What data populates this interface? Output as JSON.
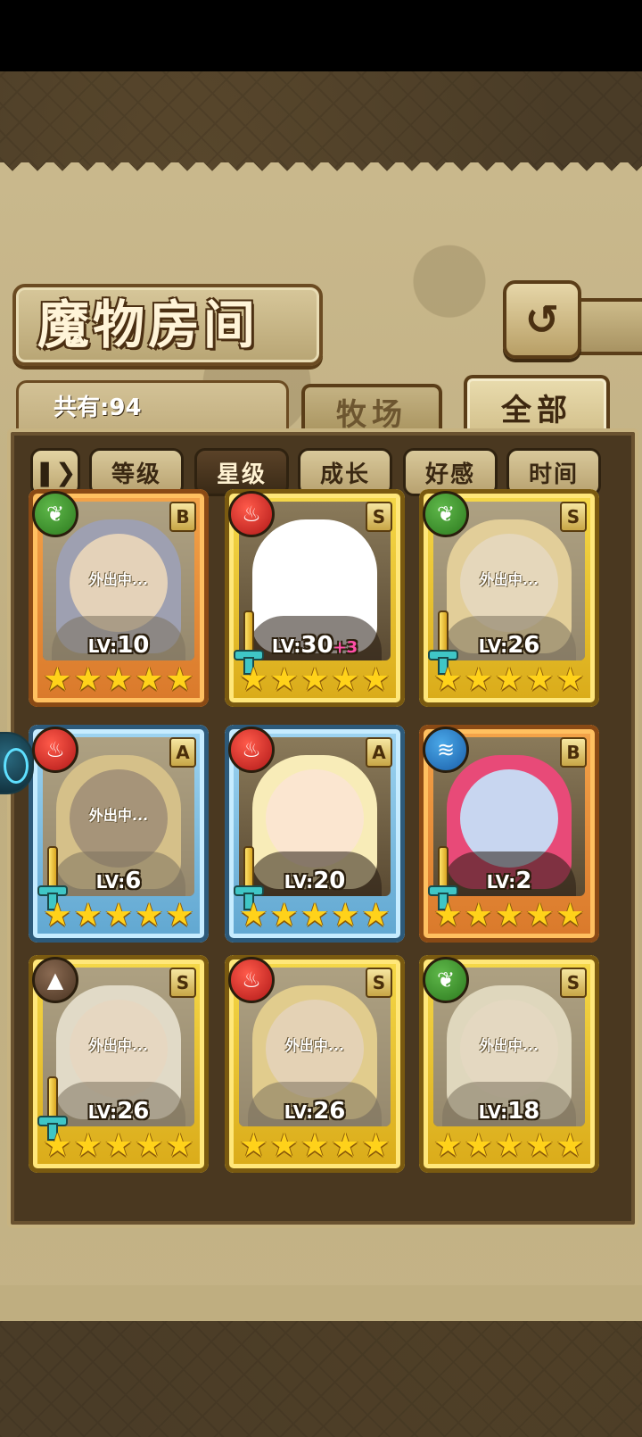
{
  "header": {
    "title": "魔物房间",
    "back_icon": "back-arrow-icon"
  },
  "count_label": "共有:94",
  "tabs": [
    {
      "label": "牧场",
      "active": false
    },
    {
      "label": "全部",
      "active": true
    }
  ],
  "sort": {
    "toggle_icon": "pause-sort-icon",
    "buttons": [
      {
        "label": "等级",
        "active": false
      },
      {
        "label": "星级",
        "active": true
      },
      {
        "label": "成长",
        "active": false
      },
      {
        "label": "好感",
        "active": false
      },
      {
        "label": "时间",
        "active": false
      }
    ]
  },
  "monsters": [
    {
      "element": "nature",
      "rank": "B",
      "frame": "orange",
      "away": "外出中...",
      "level": "10",
      "bonus": "",
      "sword": false,
      "stars": 5,
      "hair": "#6a78b8",
      "skin": "#f6dcc8"
    },
    {
      "element": "fire",
      "rank": "S",
      "frame": "gold",
      "away": "",
      "level": "30",
      "bonus": "+3",
      "sword": true,
      "stars": 5,
      "hair": "#ffffff",
      "skin": "#ffffff"
    },
    {
      "element": "nature",
      "rank": "S",
      "frame": "gold",
      "away": "外出中...",
      "level": "26",
      "bonus": "",
      "sword": true,
      "stars": 5,
      "hair": "#f2d488",
      "skin": "#f8e6cc"
    },
    {
      "element": "fire",
      "rank": "A",
      "frame": "blue",
      "away": "外出中...",
      "level": "6",
      "bonus": "",
      "sword": true,
      "stars": 5,
      "hair": "#d8b868",
      "skin": "#7a6048"
    },
    {
      "element": "fire",
      "rank": "A",
      "frame": "blue",
      "away": "",
      "level": "20",
      "bonus": "",
      "sword": true,
      "stars": 5,
      "hair": "#f8ecb8",
      "skin": "#fbe6d0"
    },
    {
      "element": "water",
      "rank": "B",
      "frame": "orange",
      "away": "",
      "level": "2",
      "bonus": "",
      "sword": true,
      "stars": 5,
      "hair": "#e84a78",
      "skin": "#c8d6f0"
    },
    {
      "element": "earth",
      "rank": "S",
      "frame": "gold",
      "away": "外出中...",
      "level": "26",
      "bonus": "",
      "sword": true,
      "stars": 5,
      "hair": "#f0ece4",
      "skin": "#fbe6d8"
    },
    {
      "element": "fire",
      "rank": "S",
      "frame": "gold",
      "away": "外出中...",
      "level": "26",
      "bonus": "",
      "sword": false,
      "stars": 5,
      "hair": "#f0d070",
      "skin": "#f6dcc0"
    },
    {
      "element": "nature",
      "rank": "S",
      "frame": "gold",
      "away": "外出中...",
      "level": "18",
      "bonus": "",
      "sword": false,
      "stars": 5,
      "hair": "#ece6d0",
      "skin": "#f6e8d8"
    }
  ],
  "lv_prefix": "LV:",
  "element_glyphs": {
    "nature": "❦",
    "fire": "♨",
    "water": "≋",
    "earth": "▲"
  }
}
